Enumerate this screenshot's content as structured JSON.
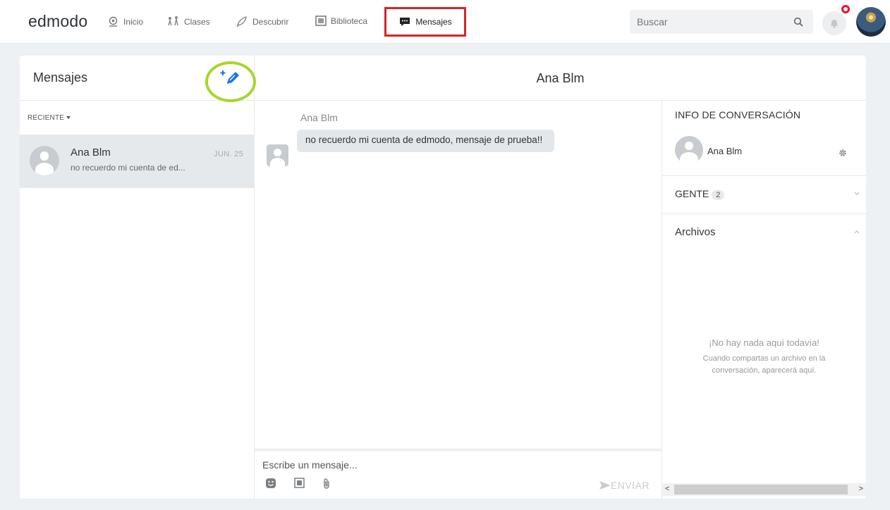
{
  "nav": {
    "logo": "edmodo",
    "items": [
      {
        "label": "Inicio"
      },
      {
        "label": "Clases"
      },
      {
        "label": "Descubrir"
      },
      {
        "label": "Biblioteca"
      },
      {
        "label": "Mensajes"
      }
    ],
    "search_placeholder": "Buscar"
  },
  "messages": {
    "title": "Mensajes",
    "filter_label": "RECIENTE",
    "threads": [
      {
        "name": "Ana Blm",
        "date": "JUN. 25",
        "preview": "no recuerdo mi cuenta de ed..."
      }
    ]
  },
  "conversation": {
    "title": "Ana Blm",
    "messages": [
      {
        "sender": "Ana Blm",
        "text": "no recuerdo mi cuenta de edmodo, mensaje de prueba!!"
      }
    ],
    "composer_placeholder": "Escribe un mensaje...",
    "send_label": "ENVIAR"
  },
  "info": {
    "title": "INFO DE CONVERSACIÓN",
    "participant": "Ana Blm",
    "people_label": "GENTE",
    "people_count": "2",
    "files_label": "Archivos",
    "empty_title": "¡No hay nada aquí todavía!",
    "empty_text": "Cuando compartas un archivo en la conversación, aparecerá aquí."
  },
  "colors": {
    "highlight_box": "#d8232a",
    "compose_ring": "#a8d52c",
    "compose_icon": "#1a73e8",
    "notification_badge": "#e8132b"
  }
}
